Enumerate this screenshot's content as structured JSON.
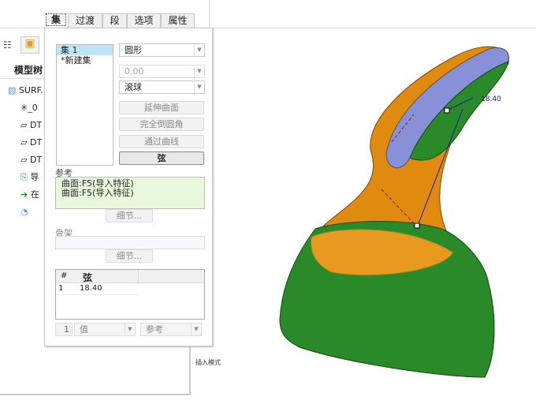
{
  "tabs": [
    "集",
    "过渡",
    "段",
    "选项",
    "属性"
  ],
  "sets": [
    "集 1",
    "*新建集"
  ],
  "shape_select": "圆形",
  "radius_value": "0.00",
  "method_select": "滚球",
  "buttons": {
    "extend": "延伸曲面",
    "full_round": "完全倒圆角",
    "through_curve": "通过曲线",
    "chord": "弦"
  },
  "references": {
    "label": "参考",
    "items": [
      "曲面:F5(导入特征)",
      "曲面:F5(导入特征)"
    ],
    "details": "细节..."
  },
  "skeleton": {
    "label": "骨架",
    "details": "细节..."
  },
  "table": {
    "headers": [
      "#",
      "弦"
    ],
    "rows": [
      [
        "1",
        "18.40"
      ]
    ]
  },
  "footer": {
    "index": "1",
    "value_select": "值",
    "ref_select": "参考"
  },
  "tree": {
    "title": "模型树",
    "items": [
      "SURF.",
      "_0",
      "DT",
      "DT",
      "DT",
      "导",
      "在",
      ""
    ]
  },
  "status": "插入模式",
  "dimension": "18.40"
}
